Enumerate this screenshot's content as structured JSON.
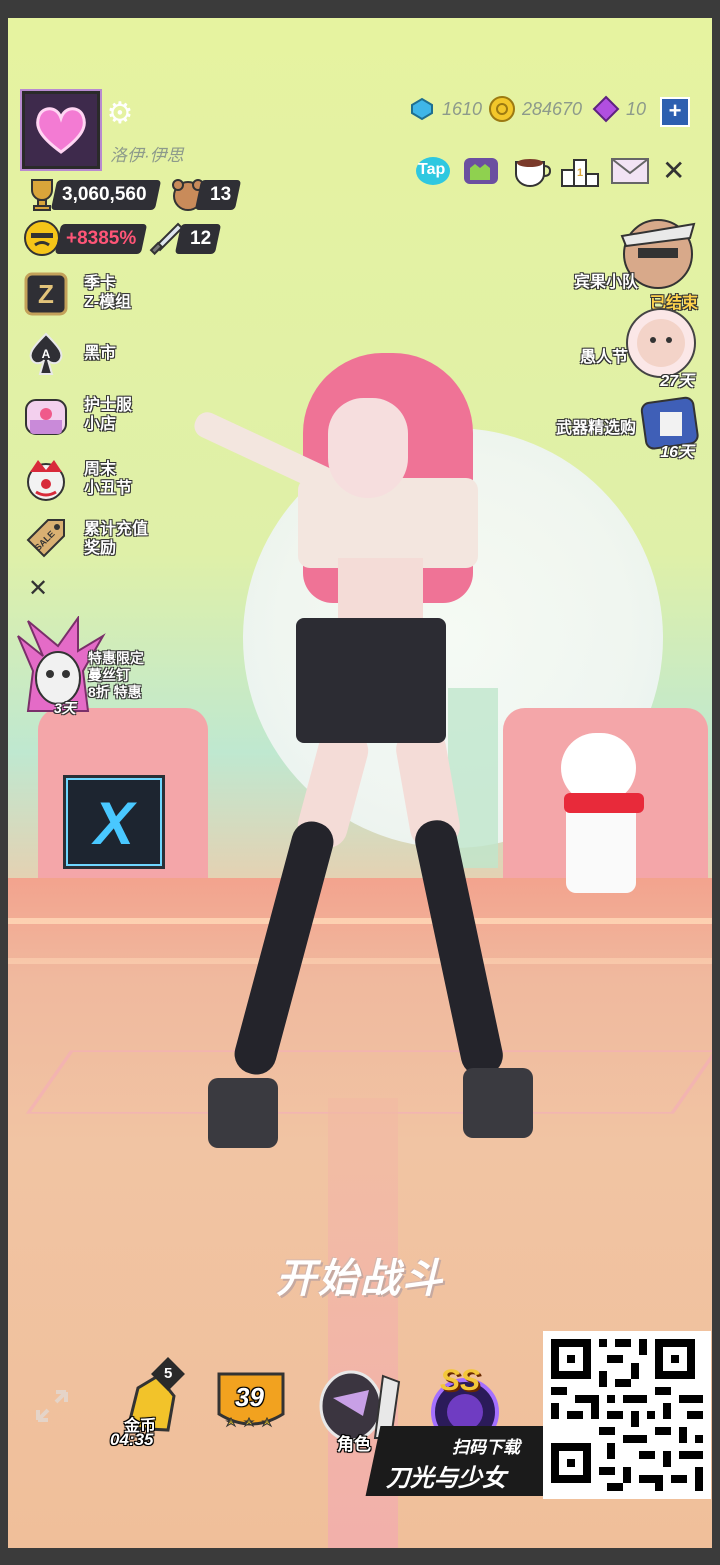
{
  "player": {
    "name": "洛伊·伊思",
    "trophies": "3,060,560",
    "bear_count": "13",
    "boost": "+8385%",
    "sword_count": "12"
  },
  "currencies": {
    "gems": "1610",
    "coins": "284670",
    "crystals": "10",
    "add_label": "+"
  },
  "left_menu": [
    {
      "id": "season-card",
      "icon": "z-icon",
      "label": "季卡\nZ-模组"
    },
    {
      "id": "black-market",
      "icon": "spade-ace-icon",
      "label": "黑市"
    },
    {
      "id": "nurse-shop",
      "icon": "nurse-shop-icon",
      "label": "护士服\n小店"
    },
    {
      "id": "clown-festival",
      "icon": "clown-icon",
      "label": "周末\n小丑节"
    },
    {
      "id": "recharge-reward",
      "icon": "sale-tag-icon",
      "label": "累计充值\n奖励"
    }
  ],
  "left_close": "✕",
  "promo": {
    "label_line1": "特惠限定",
    "label_line2": "蔓丝钉",
    "label_line3": "8折 特惠",
    "days": "3天"
  },
  "right_events": [
    {
      "id": "party-squad",
      "label": "宾果小队",
      "status": "已结束"
    },
    {
      "id": "april-fools",
      "label": "愚人节",
      "days": "27天"
    },
    {
      "id": "weapon-selection",
      "label": "武器精选购",
      "days": "16天"
    }
  ],
  "top_buttons": {
    "tap_label": "Tap",
    "close": "✕"
  },
  "start_label": "开始战斗",
  "bottom": {
    "gold_label": "金币",
    "gold_timer": "04:35",
    "gold_badge": "5",
    "level": "39",
    "character_label": "角色",
    "rank": "SS",
    "download_line1": "扫码下载",
    "download_line2": "刀光与少女"
  },
  "colors": {
    "accent_pink": "#ef7396",
    "panel_dark": "#2f2f35",
    "gold": "#f5c518",
    "boost_red": "#ff5577"
  }
}
